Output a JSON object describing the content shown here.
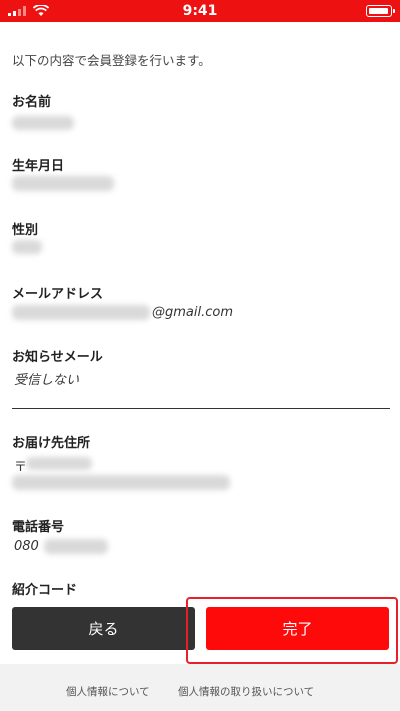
{
  "status_bar": {
    "time": "9:41"
  },
  "intro": "以下の内容で会員登録を行います。",
  "fields": {
    "name": {
      "label": "お名前"
    },
    "birthdate": {
      "label": "生年月日"
    },
    "gender": {
      "label": "性別"
    },
    "email": {
      "label": "メールアドレス",
      "value_suffix": "@gmail.com"
    },
    "newsletter": {
      "label": "お知らせメール",
      "value": "受信しない"
    },
    "address": {
      "label": "お届け先住所",
      "postal_prefix": "〒"
    },
    "phone": {
      "label": "電話番号",
      "value_prefix": "080"
    },
    "referral": {
      "label": "紹介コード"
    }
  },
  "buttons": {
    "back": "戻る",
    "complete": "完了"
  },
  "footer": {
    "about_privacy": "個人情報について",
    "privacy_handling": "個人情報の取り扱いについて"
  },
  "colors": {
    "accent": "#ff0a0a",
    "status_bar": "#ee1111",
    "back_button": "#333333",
    "highlight": "#e8202a"
  }
}
